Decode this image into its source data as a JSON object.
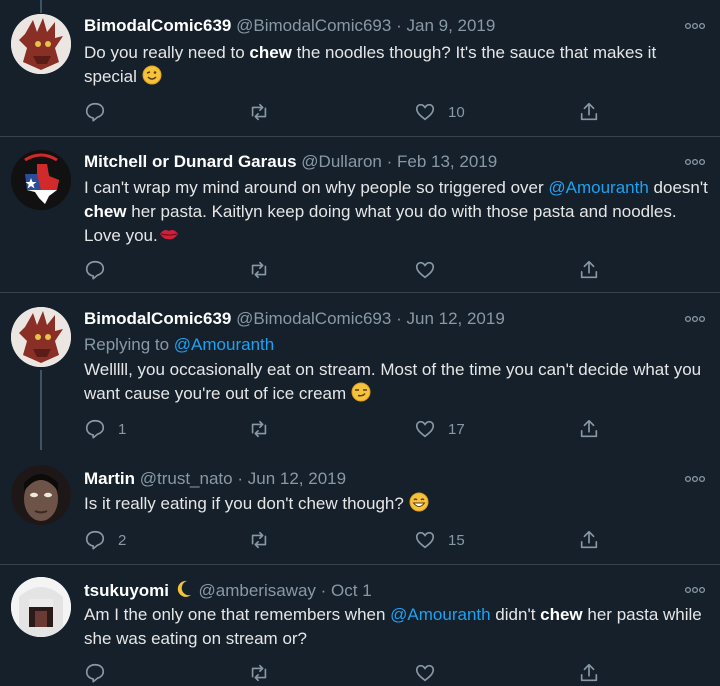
{
  "tweets": [
    {
      "name": "BimodalComic639",
      "handle": "@BimodalComic693",
      "date": "Jan 9, 2019",
      "text_parts": [
        "Do you really need to ",
        "chew",
        " the noodles though? It's the sauce that makes it special"
      ],
      "emoji": "wink",
      "reply_count": "",
      "retweet_count": "",
      "like_count": "10"
    },
    {
      "name": "Mitchell or Dunard Garaus",
      "handle": "@Dullaron",
      "date": "Feb 13, 2019",
      "text_parts": [
        "I can't wrap my mind around on why people so triggered over ",
        "@Amouranth",
        " doesn't ",
        "chew",
        " her pasta. Kaitlyn keep doing what you do with those pasta and noodles. Love you."
      ],
      "emoji": "kiss-lips",
      "reply_count": "",
      "retweet_count": "",
      "like_count": ""
    },
    {
      "name": "BimodalComic639",
      "handle": "@BimodalComic693",
      "date": "Jun 12, 2019",
      "replying_to_label": "Replying to",
      "replying_to_handle": "@Amouranth",
      "text_parts": [
        "Welllll, you occasionally eat on stream. Most of the time you can't decide what you want cause you're out of ice cream"
      ],
      "emoji": "smirk",
      "reply_count": "1",
      "retweet_count": "",
      "like_count": "17"
    },
    {
      "name": "Martin",
      "handle": "@trust_nato",
      "date": "Jun 12, 2019",
      "text_parts": [
        "Is it really eating if you don't chew though?"
      ],
      "emoji": "grin",
      "reply_count": "2",
      "retweet_count": "",
      "like_count": "15"
    },
    {
      "name": "tsukuyomi",
      "name_emoji": "crescent-moon",
      "handle": "@amberisaway",
      "date": "Oct 1",
      "text_parts": [
        "Am I the only one that remembers when ",
        "@Amouranth",
        " didn't ",
        "chew",
        " her pasta while she was eating on stream or?"
      ],
      "emoji": "",
      "reply_count": "",
      "retweet_count": "",
      "like_count": ""
    }
  ],
  "separator": "·",
  "colors": {
    "background": "#15202b",
    "link": "#1da1f2",
    "muted": "#8899a6",
    "divider": "#38444d"
  }
}
